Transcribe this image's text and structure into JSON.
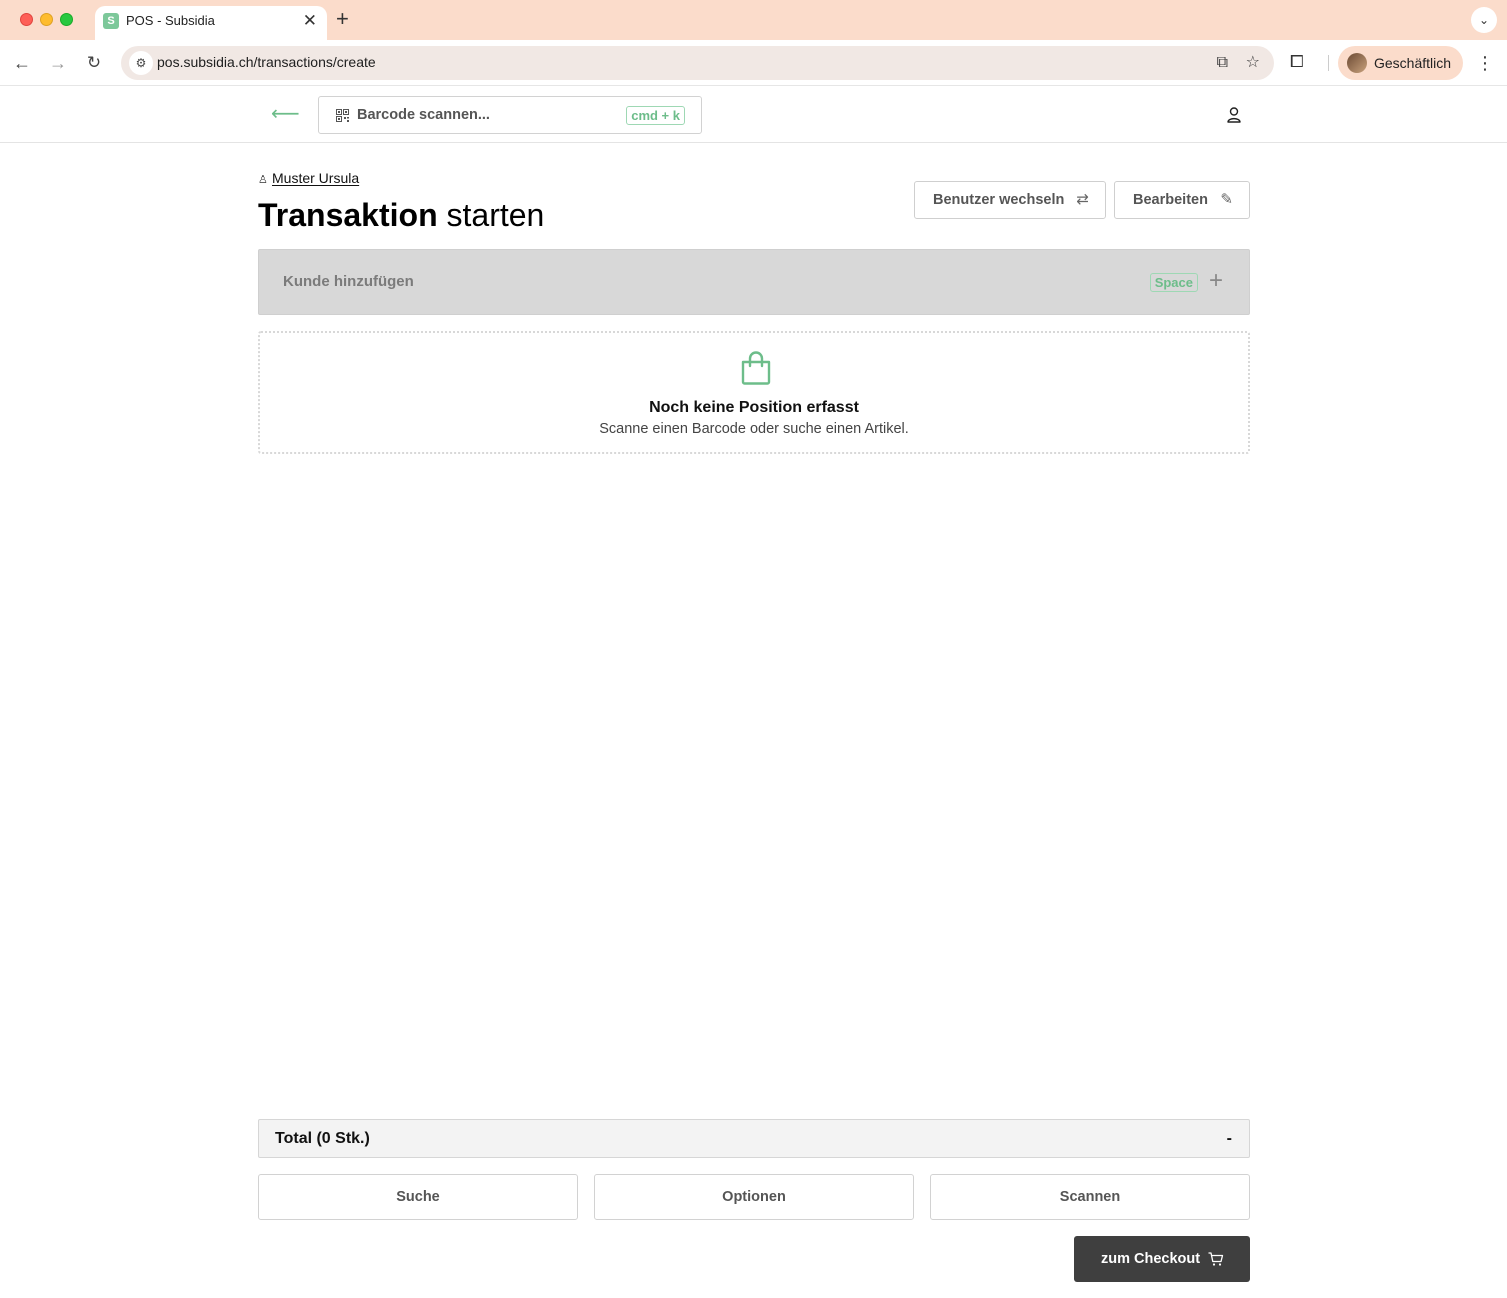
{
  "browser": {
    "tab_title": "POS - Subsidia",
    "tab_favicon": "subsidia-logo-icon",
    "url": "pos.subsidia.ch/transactions/create",
    "profile_name": "Geschäftlich"
  },
  "header": {
    "barcode_placeholder": "Barcode scannen...",
    "barcode_shortcut": "cmd + k"
  },
  "main": {
    "cashier_name": "Muster Ursula",
    "title_bold": "Transaktion",
    "title_light": "starten",
    "switch_user_label": "Benutzer wechseln",
    "edit_label": "Bearbeiten",
    "add_customer_label": "Kunde hinzufügen",
    "add_customer_shortcut": "Space",
    "empty_title": "Noch keine Position erfasst",
    "empty_subtitle": "Scanne einen Barcode oder suche einen Artikel."
  },
  "footer": {
    "total_label": "Total (0 Stk.)",
    "total_value": "-",
    "search_label": "Suche",
    "options_label": "Optionen",
    "scan_label": "Scannen",
    "checkout_label": "zum Checkout"
  },
  "colors": {
    "accent_green": "#6dbd8a",
    "tabstrip": "#fbdccb",
    "checkout_bg": "#3f3f3f"
  }
}
